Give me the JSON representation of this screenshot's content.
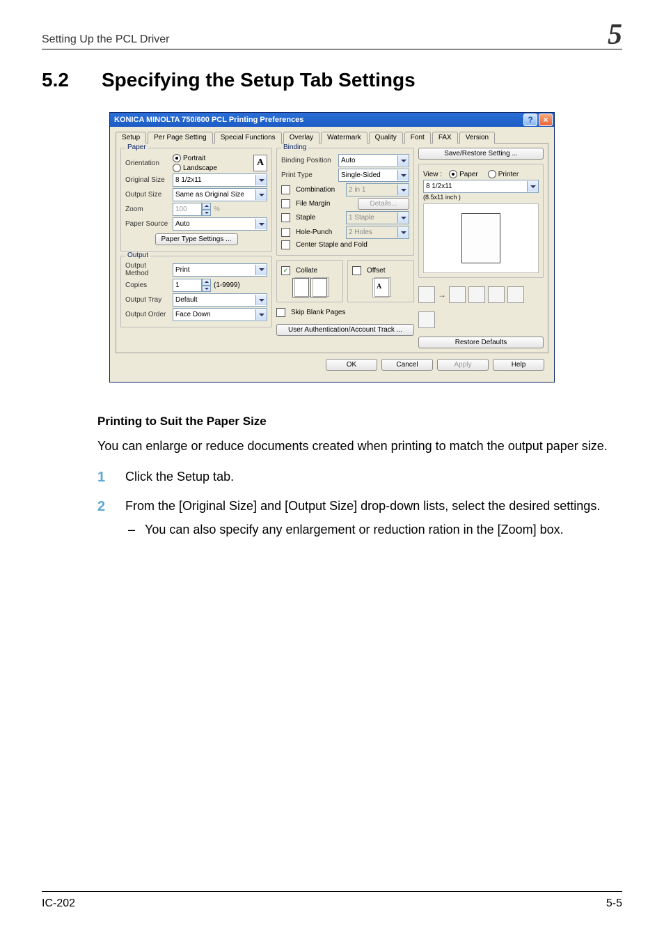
{
  "page": {
    "running_head": "Setting Up the PCL Driver",
    "chapter_number": "5",
    "section_number": "5.2",
    "section_title": "Specifying the Setup Tab Settings",
    "subhead": "Printing to Suit the Paper Size",
    "intro_para": "You can enlarge or reduce documents created when printing to match the output paper size.",
    "steps": [
      "Click the Setup tab.",
      "From the [Original Size] and [Output Size] drop-down lists, select the desired settings."
    ],
    "step2_bullets": [
      "You can also specify any enlargement or reduction ration in the [Zoom] box."
    ],
    "footer_left": "IC-202",
    "footer_right": "5-5"
  },
  "dialog": {
    "title": "KONICA MINOLTA 750/600 PCL Printing Preferences",
    "tabs": [
      "Setup",
      "Per Page Setting",
      "Special Functions",
      "Overlay",
      "Watermark",
      "Quality",
      "Font",
      "FAX",
      "Version"
    ],
    "active_tab": 0,
    "paper": {
      "legend": "Paper",
      "orientation_label": "Orientation",
      "orientation_portrait": "Portrait",
      "orientation_landscape": "Landscape",
      "orientation_value": "Portrait",
      "original_size_label": "Original Size",
      "original_size_value": "8 1/2x11",
      "output_size_label": "Output Size",
      "output_size_value": "Same as Original Size",
      "zoom_label": "Zoom",
      "zoom_value": "100",
      "zoom_unit": "%",
      "paper_source_label": "Paper Source",
      "paper_source_value": "Auto",
      "paper_type_settings": "Paper Type Settings ...",
      "orient_icon_letter": "A"
    },
    "binding": {
      "legend": "Binding",
      "position_label": "Binding Position",
      "position_value": "Auto",
      "print_type_label": "Print Type",
      "print_type_value": "Single-Sided",
      "combination_label": "Combination",
      "combination_value": "2 in 1",
      "file_margin_label": "File Margin",
      "details_btn": "Details...",
      "staple_label": "Staple",
      "staple_value": "1 Staple",
      "holepunch_label": "Hole-Punch",
      "holepunch_value": "2 Holes",
      "center_label": "Center Staple and Fold"
    },
    "output": {
      "legend": "Output",
      "method_label": "Output Method",
      "method_value": "Print",
      "copies_label": "Copies",
      "copies_value": "1",
      "copies_range": "(1-9999)",
      "tray_label": "Output Tray",
      "tray_value": "Default",
      "order_label": "Output Order",
      "order_value": "Face Down",
      "collate_label": "Collate",
      "offset_label": "Offset",
      "skip_blank_label": "Skip Blank Pages",
      "user_auth_btn": "User Authentication/Account Track ..."
    },
    "right": {
      "save_restore": "Save/Restore Setting ...",
      "view_label": "View :",
      "view_paper": "Paper",
      "view_printer": "Printer",
      "size_select_value": "8 1/2x11",
      "size_caption": "(8.5x11 inch )",
      "restore_defaults": "Restore Defaults"
    },
    "buttons": {
      "ok": "OK",
      "cancel": "Cancel",
      "apply": "Apply",
      "help": "Help"
    }
  }
}
